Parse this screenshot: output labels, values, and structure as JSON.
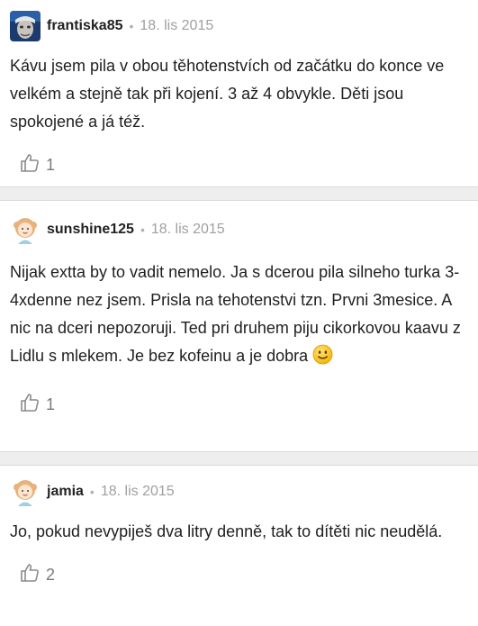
{
  "comments": [
    {
      "username": "frantiska85",
      "separator": "•",
      "date": "18. lis 2015",
      "text": "Kávu jsem pila v obou těhotenstvích od začátku do konce ve velkém a stejně tak při kojení. 3 až 4 obvykle. Děti jsou spokojené a já též.",
      "likes": "1"
    },
    {
      "username": "sunshine125",
      "separator": "•",
      "date": "18. lis 2015",
      "text": "Nijak extta by to vadit nemelo. Ja s dcerou pila silneho turka 3-4xdenne nez jsem. Prisla na tehotenstvi tzn. Prvni 3mesice. A nic na dceri nepozoruji. Ted pri druhem piju cikorkovou kaavu z Lidlu s mlekem. Je bez kofeinu a je dobra",
      "emoji": "slightly-smiling-face-icon",
      "likes": "1"
    },
    {
      "username": "jamia",
      "separator": "•",
      "date": "18. lis 2015",
      "text": "Jo, pokud nevypiješ dva litry denně, tak to dítěti nic neudělá.",
      "likes": "2"
    }
  ],
  "colors": {
    "divider_bg": "#eeeeee",
    "muted_text": "#a0a0a0",
    "like_icon": "#8a8a8a"
  }
}
